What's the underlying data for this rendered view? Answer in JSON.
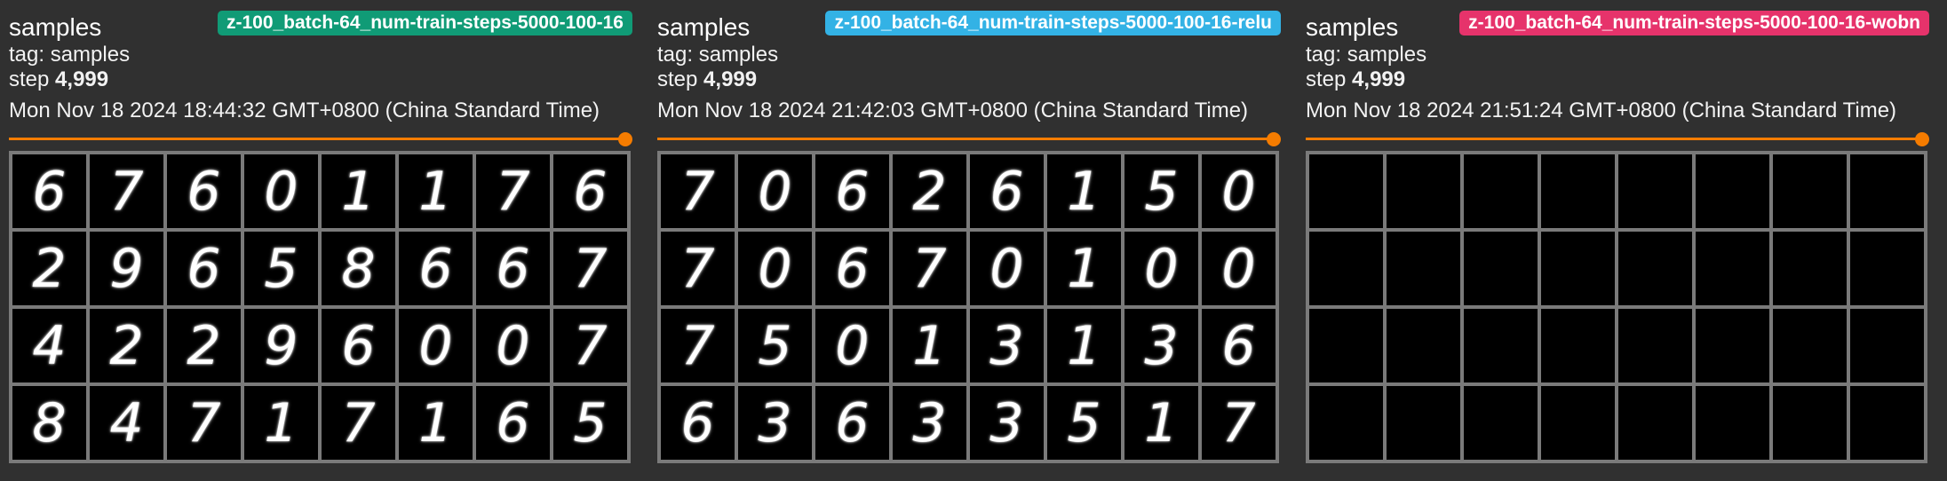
{
  "cards": [
    {
      "title": "samples",
      "run": "z-100_batch-64_num-train-steps-5000-100-16",
      "run_color": "#109b76",
      "tag_label": "tag: samples",
      "step_label": "step",
      "step_value": "4,999",
      "wall_time": "Mon Nov 18 2024 18:44:32 GMT+0800 (China Standard Time)",
      "slider_color": "#f57c00",
      "sample_digits": [
        "6",
        "7",
        "6",
        "0",
        "1",
        "1",
        "7",
        "6",
        "2",
        "9",
        "6",
        "5",
        "8",
        "6",
        "6",
        "7",
        "4",
        "2",
        "2",
        "9",
        "6",
        "0",
        "0",
        "7",
        "8",
        "4",
        "7",
        "1",
        "7",
        "1",
        "6",
        "5"
      ]
    },
    {
      "title": "samples",
      "run": "z-100_batch-64_num-train-steps-5000-100-16-relu",
      "run_color": "#33b2e5",
      "tag_label": "tag: samples",
      "step_label": "step",
      "step_value": "4,999",
      "wall_time": "Mon Nov 18 2024 21:42:03 GMT+0800 (China Standard Time)",
      "slider_color": "#f57c00",
      "sample_digits": [
        "7",
        "0",
        "6",
        "2",
        "6",
        "1",
        "5",
        "0",
        "7",
        "0",
        "6",
        "7",
        "0",
        "1",
        "0",
        "0",
        "7",
        "5",
        "0",
        "1",
        "3",
        "1",
        "3",
        "6",
        "6",
        "3",
        "6",
        "3",
        "3",
        "5",
        "1",
        "7"
      ]
    },
    {
      "title": "samples",
      "run": "z-100_batch-64_num-train-steps-5000-100-16-wobn",
      "run_color": "#e6336b",
      "tag_label": "tag: samples",
      "step_label": "step",
      "step_value": "4,999",
      "wall_time": "Mon Nov 18 2024 21:51:24 GMT+0800 (China Standard Time)",
      "slider_color": "#f57c00",
      "sample_digits": [
        "",
        "",
        "",
        "",
        "",
        "",
        "",
        "",
        "",
        "",
        "",
        "",
        "",
        "",
        "",
        "",
        "",
        "",
        "",
        "",
        "",
        "",
        "",
        "",
        "",
        "",
        "",
        "",
        "",
        "",
        "",
        ""
      ]
    }
  ]
}
